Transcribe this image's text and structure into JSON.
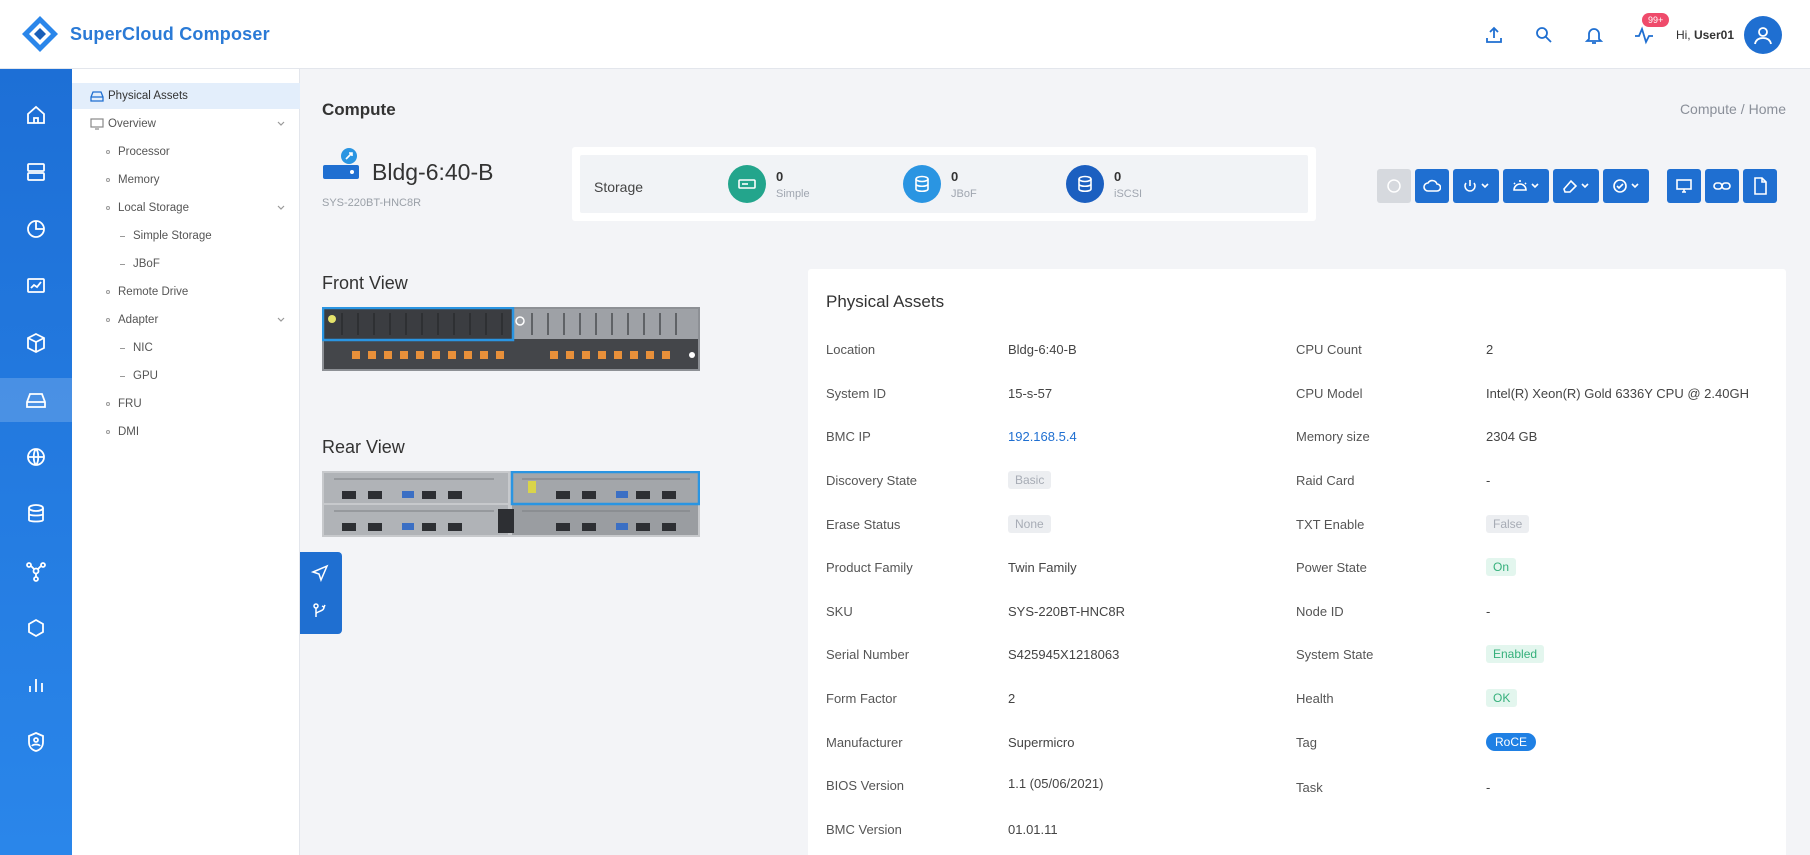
{
  "app": {
    "brand": "SuperCloud Composer"
  },
  "header": {
    "greeting": "Hi,",
    "username": "User01",
    "alert_badge": "99+"
  },
  "tree": {
    "items": [
      {
        "label": "Physical Assets",
        "level": 0
      },
      {
        "label": "Overview",
        "level": 0
      },
      {
        "label": "Processor",
        "level": 1
      },
      {
        "label": "Memory",
        "level": 1
      },
      {
        "label": "Local Storage",
        "level": 1
      },
      {
        "label": "Simple Storage",
        "level": 2
      },
      {
        "label": "JBoF",
        "level": 2
      },
      {
        "label": "Remote Drive",
        "level": 1
      },
      {
        "label": "Adapter",
        "level": 1
      },
      {
        "label": "NIC",
        "level": 2
      },
      {
        "label": "GPU",
        "level": 2
      },
      {
        "label": "FRU",
        "level": 1
      },
      {
        "label": "DMI",
        "level": 1
      }
    ]
  },
  "page": {
    "title": "Compute",
    "breadcrumb": [
      "Compute",
      "Home"
    ],
    "server_name": "Bldg-6:40-B",
    "server_sku": "SYS-220BT-HNC8R",
    "front_view_label": "Front View",
    "rear_view_label": "Rear View"
  },
  "storage": {
    "label": "Storage",
    "items": [
      {
        "value": "0",
        "name": "Simple",
        "color": "#23a58c"
      },
      {
        "value": "0",
        "name": "JBoF",
        "color": "#2a95e2"
      },
      {
        "value": "0",
        "name": "iSCSI",
        "color": "#1b5fc0"
      }
    ]
  },
  "assets": {
    "title": "Physical Assets",
    "left": [
      {
        "label": "Location",
        "value": "Bldg-6:40-B",
        "kind": "text"
      },
      {
        "label": "System ID",
        "value": "15-s-57",
        "kind": "text"
      },
      {
        "label": "BMC IP",
        "value": "192.168.5.4",
        "kind": "link"
      },
      {
        "label": "Discovery State",
        "value": "Basic",
        "kind": "gray"
      },
      {
        "label": "Erase Status",
        "value": "None",
        "kind": "gray"
      },
      {
        "label": "Product Family",
        "value": "Twin Family",
        "kind": "text"
      },
      {
        "label": "SKU",
        "value": "SYS-220BT-HNC8R",
        "kind": "text"
      },
      {
        "label": "Serial Number",
        "value": "S425945X1218063",
        "kind": "text"
      },
      {
        "label": "Form Factor",
        "value": "2",
        "kind": "text"
      },
      {
        "label": "Manufacturer",
        "value": "Supermicro",
        "kind": "text"
      },
      {
        "label": "BIOS Version",
        "value": "1.1 (05/06/2021)",
        "kind": "text"
      },
      {
        "label": "BMC Version",
        "value": "01.01.11",
        "kind": "text"
      }
    ],
    "right": [
      {
        "label": "CPU Count",
        "value": "2",
        "kind": "text"
      },
      {
        "label": "CPU Model",
        "value": "Intel(R) Xeon(R) Gold 6336Y CPU @ 2.40GH",
        "kind": "text"
      },
      {
        "label": "Memory size",
        "value": "2304 GB",
        "kind": "text"
      },
      {
        "label": "Raid Card",
        "value": "-",
        "kind": "text"
      },
      {
        "label": "TXT Enable",
        "value": "False",
        "kind": "gray"
      },
      {
        "label": "Power State",
        "value": "On",
        "kind": "green"
      },
      {
        "label": "Node ID",
        "value": "-",
        "kind": "text"
      },
      {
        "label": "System State",
        "value": "Enabled",
        "kind": "green"
      },
      {
        "label": "Health",
        "value": "OK",
        "kind": "green"
      },
      {
        "label": "Tag",
        "value": "RoCE",
        "kind": "blue"
      },
      {
        "label": "Task",
        "value": "-",
        "kind": "text"
      }
    ]
  }
}
